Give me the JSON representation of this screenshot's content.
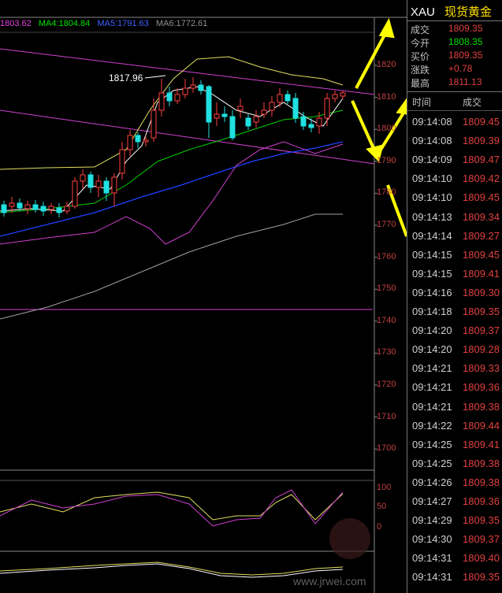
{
  "symbol": "XAU",
  "instrument_name": "现货黄金",
  "ma_legend": [
    {
      "label": "1803.62",
      "color": "#e040e0"
    },
    {
      "label": "MA4:1804.84",
      "color": "#00e000"
    },
    {
      "label": "MA5:1791.63",
      "color": "#4060ff"
    },
    {
      "label": "MA6:1772.61",
      "color": "#909090"
    }
  ],
  "high_annotation": "1817.96",
  "y_axis": [
    "1820",
    "1810",
    "1800",
    "1790",
    "1780",
    "1770",
    "1760",
    "1750",
    "1740",
    "1730",
    "1720",
    "1710",
    "1700"
  ],
  "osc_axis": [
    "100",
    "50",
    "0"
  ],
  "quote": [
    {
      "key": "成交",
      "value": "1809.35",
      "color": "#e04040"
    },
    {
      "key": "今开",
      "value": "1808.35",
      "color": "#00e000"
    },
    {
      "key": "买价",
      "value": "1809.35",
      "color": "#e04040"
    },
    {
      "key": "涨跌",
      "value": "+0.78",
      "color": "#e04040"
    },
    {
      "key": "最高",
      "value": "1811.13",
      "color": "#e04040"
    }
  ],
  "ticks_header": {
    "time": "时间",
    "price": "成交"
  },
  "ticks": [
    {
      "time": "09:14:08",
      "price": "1809.45"
    },
    {
      "time": "09:14:08",
      "price": "1809.39"
    },
    {
      "time": "09:14:09",
      "price": "1809.47"
    },
    {
      "time": "09:14:10",
      "price": "1809.42"
    },
    {
      "time": "09:14:10",
      "price": "1809.45"
    },
    {
      "time": "09:14:13",
      "price": "1809.34"
    },
    {
      "time": "09:14:14",
      "price": "1809.27"
    },
    {
      "time": "09:14:15",
      "price": "1809.45"
    },
    {
      "time": "09:14:15",
      "price": "1809.41"
    },
    {
      "time": "09:14:16",
      "price": "1809.30"
    },
    {
      "time": "09:14:18",
      "price": "1809.35"
    },
    {
      "time": "09:14:20",
      "price": "1809.37"
    },
    {
      "time": "09:14:20",
      "price": "1809.28"
    },
    {
      "time": "09:14:21",
      "price": "1809.33"
    },
    {
      "time": "09:14:21",
      "price": "1809.36"
    },
    {
      "time": "09:14:21",
      "price": "1809.38"
    },
    {
      "time": "09:14:22",
      "price": "1809.44"
    },
    {
      "time": "09:14:25",
      "price": "1809.41"
    },
    {
      "time": "09:14:25",
      "price": "1809.38"
    },
    {
      "time": "09:14:26",
      "price": "1809.38"
    },
    {
      "time": "09:14:27",
      "price": "1809.36"
    },
    {
      "time": "09:14:29",
      "price": "1809.35"
    },
    {
      "time": "09:14:30",
      "price": "1809.37"
    },
    {
      "time": "09:14:31",
      "price": "1809.40"
    },
    {
      "time": "09:14:31",
      "price": "1809.35"
    }
  ],
  "watermark": "www.jrwei.com"
}
